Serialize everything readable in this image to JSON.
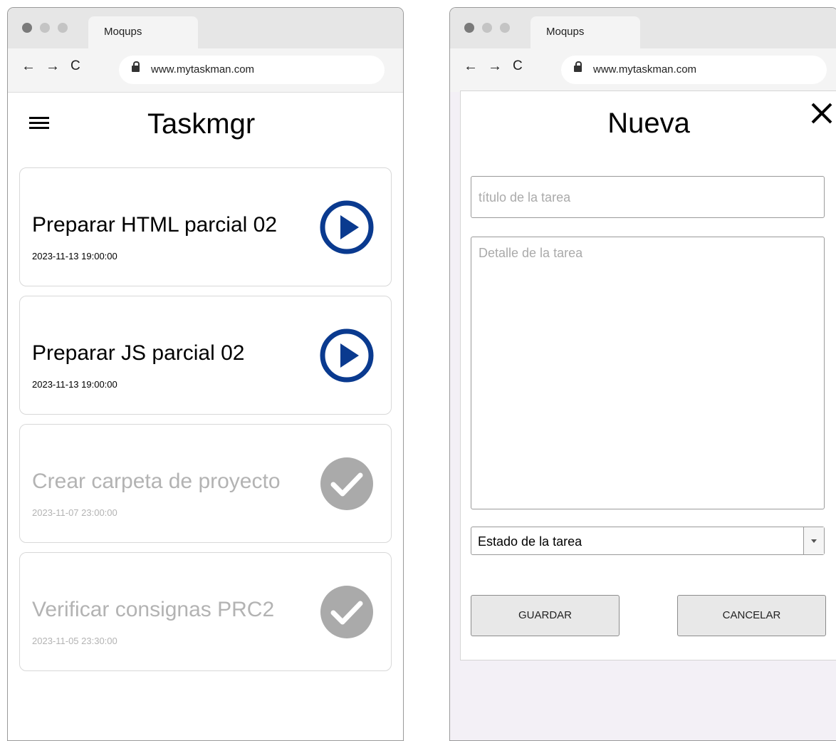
{
  "left_window": {
    "tab_label": "Moqups",
    "url": "www.mytaskman.com",
    "nav": {
      "back": "←",
      "forward": "→",
      "reload": "C"
    },
    "app_title": "Taskmgr",
    "tasks": [
      {
        "title": "Preparar HTML parcial 02",
        "date": "2023-11-13 19:00:00",
        "state": "pending",
        "icon": "play-icon"
      },
      {
        "title": "Preparar JS parcial 02",
        "date": "2023-11-13 19:00:00",
        "state": "pending",
        "icon": "play-icon"
      },
      {
        "title": "Crear carpeta de proyecto",
        "date": "2023-11-07 23:00:00",
        "state": "done",
        "icon": "check-icon"
      },
      {
        "title": "Verificar consignas PRC2",
        "date": "2023-11-05 23:30:00",
        "state": "done",
        "icon": "check-icon"
      }
    ]
  },
  "right_window": {
    "tab_label": "Moqups",
    "url": "www.mytaskman.com",
    "nav": {
      "back": "←",
      "forward": "→",
      "reload": "C"
    },
    "dialog": {
      "title": "Nueva",
      "title_placeholder": "título de la tarea",
      "detail_placeholder": "Detalle de la tarea",
      "status_select": "Estado de la tarea",
      "save_label": "GUARDAR",
      "cancel_label": "CANCELAR"
    }
  },
  "colors": {
    "play_accent": "#0a3a8f",
    "done_accent": "#aaaaaa",
    "done_text": "#b3b3b3",
    "backdrop": "#f3f0f6"
  }
}
